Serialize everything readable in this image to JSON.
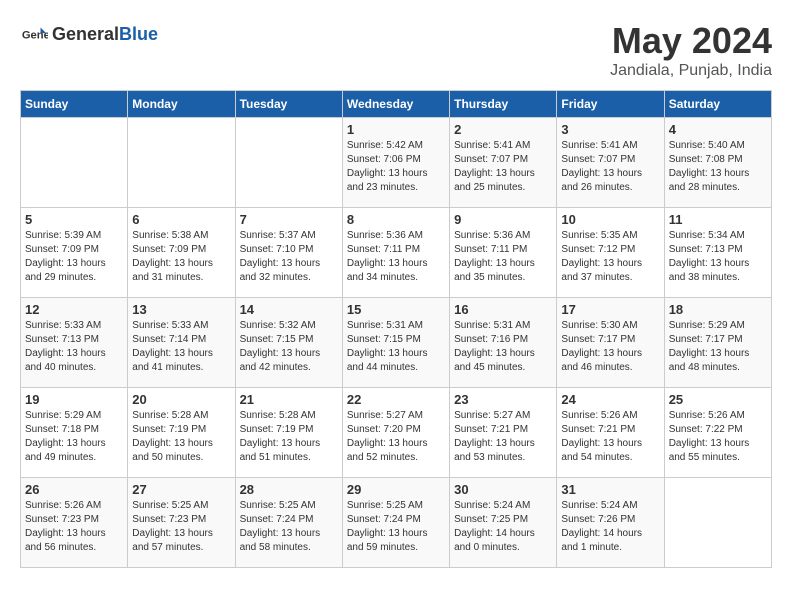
{
  "header": {
    "logo_general": "General",
    "logo_blue": "Blue",
    "month_year": "May 2024",
    "location": "Jandiala, Punjab, India"
  },
  "days_of_week": [
    "Sunday",
    "Monday",
    "Tuesday",
    "Wednesday",
    "Thursday",
    "Friday",
    "Saturday"
  ],
  "weeks": [
    [
      {
        "day": "",
        "content": ""
      },
      {
        "day": "",
        "content": ""
      },
      {
        "day": "",
        "content": ""
      },
      {
        "day": "1",
        "content": "Sunrise: 5:42 AM\nSunset: 7:06 PM\nDaylight: 13 hours\nand 23 minutes."
      },
      {
        "day": "2",
        "content": "Sunrise: 5:41 AM\nSunset: 7:07 PM\nDaylight: 13 hours\nand 25 minutes."
      },
      {
        "day": "3",
        "content": "Sunrise: 5:41 AM\nSunset: 7:07 PM\nDaylight: 13 hours\nand 26 minutes."
      },
      {
        "day": "4",
        "content": "Sunrise: 5:40 AM\nSunset: 7:08 PM\nDaylight: 13 hours\nand 28 minutes."
      }
    ],
    [
      {
        "day": "5",
        "content": "Sunrise: 5:39 AM\nSunset: 7:09 PM\nDaylight: 13 hours\nand 29 minutes."
      },
      {
        "day": "6",
        "content": "Sunrise: 5:38 AM\nSunset: 7:09 PM\nDaylight: 13 hours\nand 31 minutes."
      },
      {
        "day": "7",
        "content": "Sunrise: 5:37 AM\nSunset: 7:10 PM\nDaylight: 13 hours\nand 32 minutes."
      },
      {
        "day": "8",
        "content": "Sunrise: 5:36 AM\nSunset: 7:11 PM\nDaylight: 13 hours\nand 34 minutes."
      },
      {
        "day": "9",
        "content": "Sunrise: 5:36 AM\nSunset: 7:11 PM\nDaylight: 13 hours\nand 35 minutes."
      },
      {
        "day": "10",
        "content": "Sunrise: 5:35 AM\nSunset: 7:12 PM\nDaylight: 13 hours\nand 37 minutes."
      },
      {
        "day": "11",
        "content": "Sunrise: 5:34 AM\nSunset: 7:13 PM\nDaylight: 13 hours\nand 38 minutes."
      }
    ],
    [
      {
        "day": "12",
        "content": "Sunrise: 5:33 AM\nSunset: 7:13 PM\nDaylight: 13 hours\nand 40 minutes."
      },
      {
        "day": "13",
        "content": "Sunrise: 5:33 AM\nSunset: 7:14 PM\nDaylight: 13 hours\nand 41 minutes."
      },
      {
        "day": "14",
        "content": "Sunrise: 5:32 AM\nSunset: 7:15 PM\nDaylight: 13 hours\nand 42 minutes."
      },
      {
        "day": "15",
        "content": "Sunrise: 5:31 AM\nSunset: 7:15 PM\nDaylight: 13 hours\nand 44 minutes."
      },
      {
        "day": "16",
        "content": "Sunrise: 5:31 AM\nSunset: 7:16 PM\nDaylight: 13 hours\nand 45 minutes."
      },
      {
        "day": "17",
        "content": "Sunrise: 5:30 AM\nSunset: 7:17 PM\nDaylight: 13 hours\nand 46 minutes."
      },
      {
        "day": "18",
        "content": "Sunrise: 5:29 AM\nSunset: 7:17 PM\nDaylight: 13 hours\nand 48 minutes."
      }
    ],
    [
      {
        "day": "19",
        "content": "Sunrise: 5:29 AM\nSunset: 7:18 PM\nDaylight: 13 hours\nand 49 minutes."
      },
      {
        "day": "20",
        "content": "Sunrise: 5:28 AM\nSunset: 7:19 PM\nDaylight: 13 hours\nand 50 minutes."
      },
      {
        "day": "21",
        "content": "Sunrise: 5:28 AM\nSunset: 7:19 PM\nDaylight: 13 hours\nand 51 minutes."
      },
      {
        "day": "22",
        "content": "Sunrise: 5:27 AM\nSunset: 7:20 PM\nDaylight: 13 hours\nand 52 minutes."
      },
      {
        "day": "23",
        "content": "Sunrise: 5:27 AM\nSunset: 7:21 PM\nDaylight: 13 hours\nand 53 minutes."
      },
      {
        "day": "24",
        "content": "Sunrise: 5:26 AM\nSunset: 7:21 PM\nDaylight: 13 hours\nand 54 minutes."
      },
      {
        "day": "25",
        "content": "Sunrise: 5:26 AM\nSunset: 7:22 PM\nDaylight: 13 hours\nand 55 minutes."
      }
    ],
    [
      {
        "day": "26",
        "content": "Sunrise: 5:26 AM\nSunset: 7:23 PM\nDaylight: 13 hours\nand 56 minutes."
      },
      {
        "day": "27",
        "content": "Sunrise: 5:25 AM\nSunset: 7:23 PM\nDaylight: 13 hours\nand 57 minutes."
      },
      {
        "day": "28",
        "content": "Sunrise: 5:25 AM\nSunset: 7:24 PM\nDaylight: 13 hours\nand 58 minutes."
      },
      {
        "day": "29",
        "content": "Sunrise: 5:25 AM\nSunset: 7:24 PM\nDaylight: 13 hours\nand 59 minutes."
      },
      {
        "day": "30",
        "content": "Sunrise: 5:24 AM\nSunset: 7:25 PM\nDaylight: 14 hours\nand 0 minutes."
      },
      {
        "day": "31",
        "content": "Sunrise: 5:24 AM\nSunset: 7:26 PM\nDaylight: 14 hours\nand 1 minute."
      },
      {
        "day": "",
        "content": ""
      }
    ]
  ]
}
